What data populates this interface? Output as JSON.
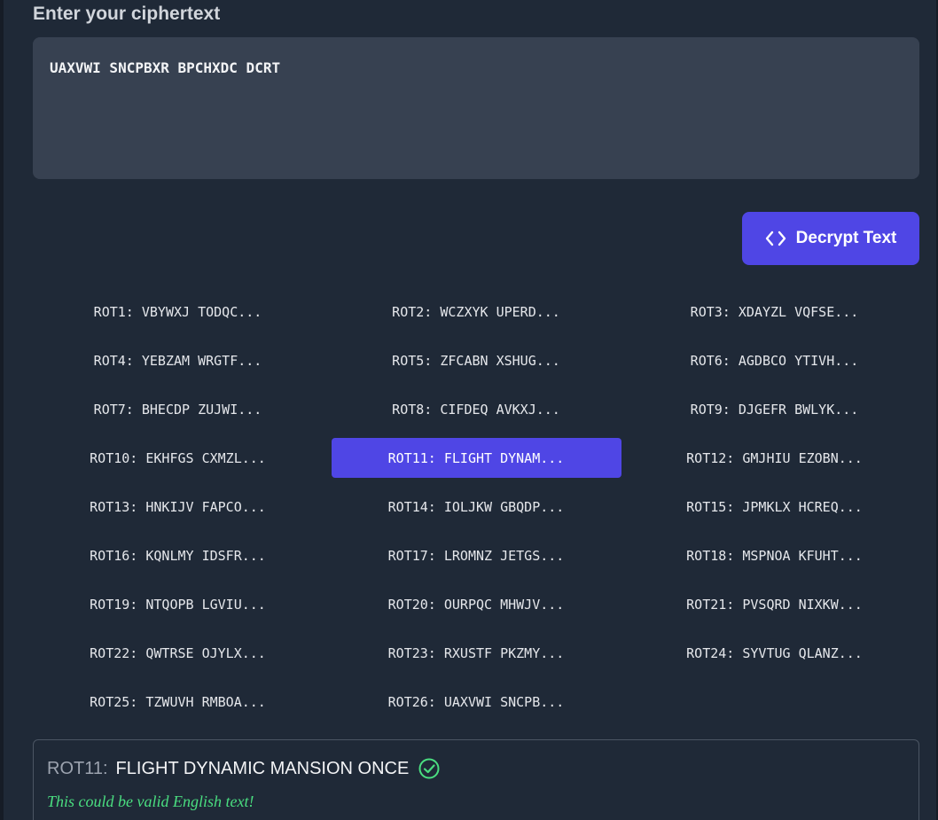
{
  "input_section": {
    "label": "Enter your ciphertext",
    "ciphertext": "UAXVWI SNCPBXR BPCHXDC DCRT"
  },
  "decrypt_button": {
    "icon": "code-brackets-icon",
    "label": "Decrypt Text"
  },
  "rotations": [
    {
      "label": "ROT1: VBYWXJ TODQC...",
      "active": false
    },
    {
      "label": "ROT2: WCZXYK UPERD...",
      "active": false
    },
    {
      "label": "ROT3: XDAYZL VQFSE...",
      "active": false
    },
    {
      "label": "ROT4: YEBZAM WRGTF...",
      "active": false
    },
    {
      "label": "ROT5: ZFCABN XSHUG...",
      "active": false
    },
    {
      "label": "ROT6: AGDBCO YTIVH...",
      "active": false
    },
    {
      "label": "ROT7: BHECDP ZUJWI...",
      "active": false
    },
    {
      "label": "ROT8: CIFDEQ AVKXJ...",
      "active": false
    },
    {
      "label": "ROT9: DJGEFR BWLYK...",
      "active": false
    },
    {
      "label": "ROT10: EKHFGS CXMZL...",
      "active": false
    },
    {
      "label": "ROT11: FLIGHT DYNAM...",
      "active": true
    },
    {
      "label": "ROT12: GMJHIU EZOBN...",
      "active": false
    },
    {
      "label": "ROT13: HNKIJV FAPCO...",
      "active": false
    },
    {
      "label": "ROT14: IOLJKW GBQDP...",
      "active": false
    },
    {
      "label": "ROT15: JPMKLX HCREQ...",
      "active": false
    },
    {
      "label": "ROT16: KQNLMY IDSFR...",
      "active": false
    },
    {
      "label": "ROT17: LROMNZ JETGS...",
      "active": false
    },
    {
      "label": "ROT18: MSPNOA KFUHT...",
      "active": false
    },
    {
      "label": "ROT19: NTQOPB LGVIU...",
      "active": false
    },
    {
      "label": "ROT20: OURPQC MHWJV...",
      "active": false
    },
    {
      "label": "ROT21: PVSQRD NIXKW...",
      "active": false
    },
    {
      "label": "ROT22: QWTRSE OJYLX...",
      "active": false
    },
    {
      "label": "ROT23: RXUSTF PKZMY...",
      "active": false
    },
    {
      "label": "ROT24: SYVTUG QLANZ...",
      "active": false
    },
    {
      "label": "ROT25: TZWUVH RMBOA...",
      "active": false
    },
    {
      "label": "ROT26: UAXVWI SNCPB...",
      "active": false
    }
  ],
  "result": {
    "rot_label": "ROT11:",
    "plaintext": "FLIGHT DYNAMIC MANSION ONCE",
    "status_icon": "check-circle-icon",
    "note": "This could be valid English text!"
  },
  "colors": {
    "background": "#1f2937",
    "input_background": "#374151",
    "accent": "#4f46e5",
    "success": "#4ade80"
  }
}
